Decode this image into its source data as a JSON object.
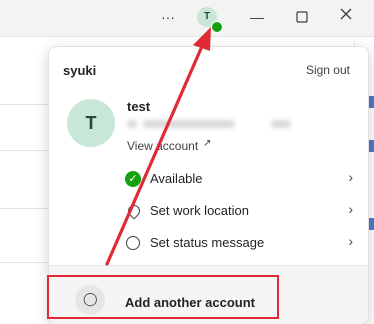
{
  "titlebar": {
    "more_icon": "more-horizontal-icon",
    "avatar_initial": "T",
    "presence": "available",
    "minimize_icon": "minimize-icon",
    "maximize_icon": "maximize-icon",
    "close_icon": "close-icon"
  },
  "flyout": {
    "org_name": "syuki",
    "sign_out": "Sign out",
    "user": {
      "avatar_initial": "T",
      "name": "test",
      "email_redacted": true,
      "view_account": "View account",
      "view_account_icon": "external-link-icon"
    },
    "menu": [
      {
        "label": "Available",
        "icon": "presence-available-icon",
        "chevron": "chevron-right-icon"
      },
      {
        "label": "Set work location",
        "icon": "location-icon",
        "chevron": "chevron-right-icon"
      },
      {
        "label": "Set status message",
        "icon": "status-message-icon",
        "chevron": "chevron-right-icon"
      }
    ],
    "add_account": {
      "label": "Add another account",
      "icon": "add-person-icon"
    }
  },
  "annotation": {
    "arrow_color": "#e02b35",
    "highlight_color": "#e02b35"
  },
  "colors": {
    "presence_green": "#13a10e",
    "avatar_bg": "#c9e7d7",
    "titlebar_bg": "#f3f3f3"
  }
}
